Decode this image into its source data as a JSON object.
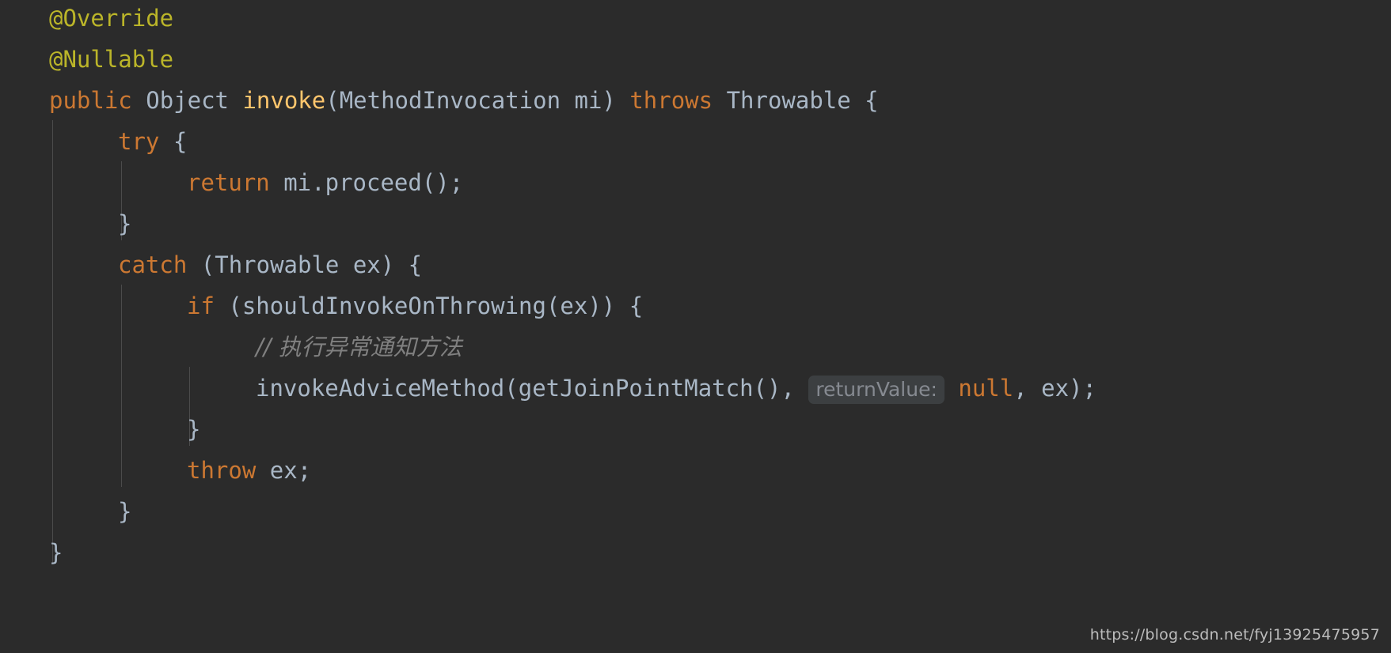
{
  "editor": {
    "theme": "darcula",
    "background_color": "#2b2b2b",
    "language": "java",
    "colors": {
      "keyword": "#cc7832",
      "annotation": "#bbb529",
      "identifier": "#a9b7c6",
      "method_declaration": "#ffc66d",
      "comment": "#808080",
      "parameter_hint_text": "#868a91",
      "parameter_hint_background": "#3c3f41",
      "indent_guide": "#4b4b4b"
    },
    "lines": [
      {
        "index": 0,
        "indent": 0,
        "tokens": [
          {
            "t": "@Override",
            "k": "anno"
          }
        ]
      },
      {
        "index": 1,
        "indent": 0,
        "tokens": [
          {
            "t": "@Nullable",
            "k": "anno"
          }
        ]
      },
      {
        "index": 2,
        "indent": 0,
        "tokens": [
          {
            "t": "public",
            "k": "kw"
          },
          {
            "t": " ",
            "k": "punct"
          },
          {
            "t": "Object",
            "k": "ident"
          },
          {
            "t": " ",
            "k": "punct"
          },
          {
            "t": "invoke",
            "k": "method"
          },
          {
            "t": "(MethodInvocation mi) ",
            "k": "ident"
          },
          {
            "t": "throws",
            "k": "kw"
          },
          {
            "t": " Throwable {",
            "k": "ident"
          }
        ]
      },
      {
        "index": 3,
        "indent": 1,
        "tokens": [
          {
            "t": "try",
            "k": "kw"
          },
          {
            "t": " {",
            "k": "punct"
          }
        ]
      },
      {
        "index": 4,
        "indent": 2,
        "tokens": [
          {
            "t": "return",
            "k": "kw"
          },
          {
            "t": " mi.proceed();",
            "k": "ident"
          }
        ]
      },
      {
        "index": 5,
        "indent": 1,
        "tokens": [
          {
            "t": "}",
            "k": "punct"
          }
        ]
      },
      {
        "index": 6,
        "indent": 1,
        "tokens": [
          {
            "t": "catch",
            "k": "kw"
          },
          {
            "t": " (Throwable ex) {",
            "k": "ident"
          }
        ]
      },
      {
        "index": 7,
        "indent": 2,
        "tokens": [
          {
            "t": "if",
            "k": "kw"
          },
          {
            "t": " (shouldInvokeOnThrowing(ex)) {",
            "k": "ident"
          }
        ]
      },
      {
        "index": 8,
        "indent": 3,
        "tokens": [
          {
            "t": "// 执行异常通知方法",
            "k": "comment"
          }
        ]
      },
      {
        "index": 9,
        "indent": 3,
        "tokens": [
          {
            "t": "invokeAdviceMethod(getJoinPointMatch(), ",
            "k": "ident"
          },
          {
            "t": "returnValue:",
            "k": "hint"
          },
          {
            "t": " ",
            "k": "punct"
          },
          {
            "t": "null",
            "k": "kw"
          },
          {
            "t": ", ex);",
            "k": "ident"
          }
        ]
      },
      {
        "index": 10,
        "indent": 2,
        "tokens": [
          {
            "t": "}",
            "k": "punct"
          }
        ]
      },
      {
        "index": 11,
        "indent": 2,
        "tokens": [
          {
            "t": "throw",
            "k": "kw"
          },
          {
            "t": " ex;",
            "k": "ident"
          }
        ]
      },
      {
        "index": 12,
        "indent": 1,
        "tokens": [
          {
            "t": "}",
            "k": "punct"
          }
        ]
      },
      {
        "index": 13,
        "indent": 0,
        "tokens": [
          {
            "t": "}",
            "k": "punct"
          }
        ]
      }
    ],
    "parameter_hints": [
      {
        "label": "returnValue:",
        "line": 9
      }
    ]
  },
  "watermark": {
    "text": "https://blog.csdn.net/fyj13925475957"
  }
}
